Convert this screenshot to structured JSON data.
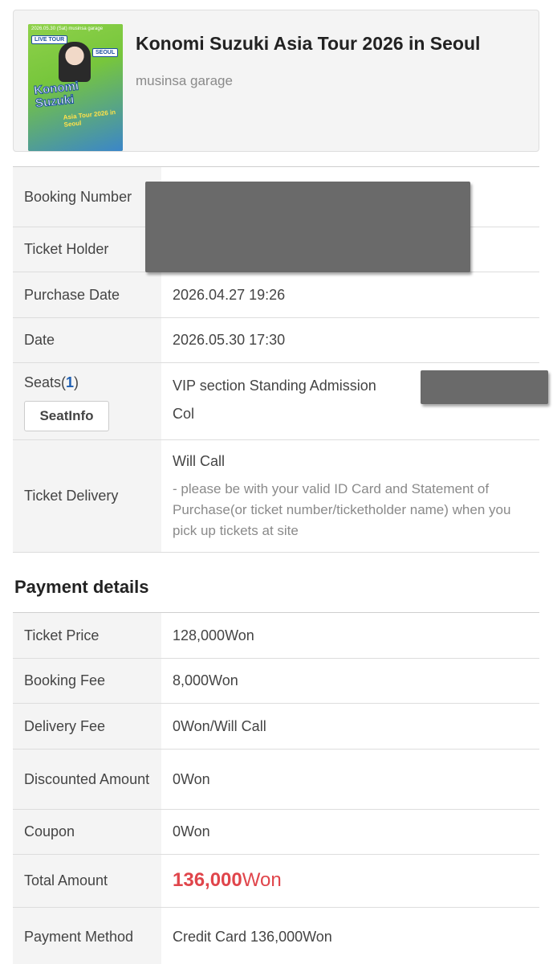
{
  "event": {
    "poster_icon": "concert-poster-image",
    "poster_text": {
      "top": "2026.05.30 (Sat)  musinsa garage",
      "tag1": "LIVE TOUR",
      "tag2": "SEOUL",
      "art_title": "Konomi Suzuki",
      "art_sub": "Asia Tour 2026 in Seoul"
    },
    "title": "Konomi Suzuki Asia Tour 2026 in Seoul",
    "venue": "musinsa garage"
  },
  "booking": {
    "booking_number_label": "Booking Number",
    "ticket_holder_label": "Ticket Holder",
    "purchase_date_label": "Purchase Date",
    "purchase_date": "2026.04.27 19:26",
    "date_label": "Date",
    "date": "2026.05.30 17:30",
    "seats_label": "Seats(",
    "seats_count": "1",
    "seats_label_end": ")",
    "seatinfo_button": "SeatInfo",
    "seat_value_line1": "VIP section Standing Admission",
    "seat_value_line2": "Col",
    "delivery_label": "Ticket Delivery",
    "delivery_method": "Will Call",
    "delivery_note": "- please be with your valid ID Card and Statement of Purchase(or ticket number/ticketholder name) when you pick up tickets at site"
  },
  "payment": {
    "section_title": "Payment details",
    "ticket_price_label": "Ticket Price",
    "ticket_price": "128,000Won",
    "booking_fee_label": "Booking Fee",
    "booking_fee": "8,000Won",
    "delivery_fee_label": "Delivery Fee",
    "delivery_fee": "0Won/Will Call",
    "discount_label": "Discounted Amount",
    "discount": "0Won",
    "coupon_label": "Coupon",
    "coupon": "0Won",
    "total_label": "Total Amount",
    "total_number": "136,000",
    "total_unit": "Won",
    "method_label": "Payment Method",
    "method": "Credit Card 136,000Won"
  },
  "colors": {
    "total_red": "#e0454b",
    "seat_count_blue": "#1f5fb2",
    "redaction": "#6a6a6a"
  }
}
